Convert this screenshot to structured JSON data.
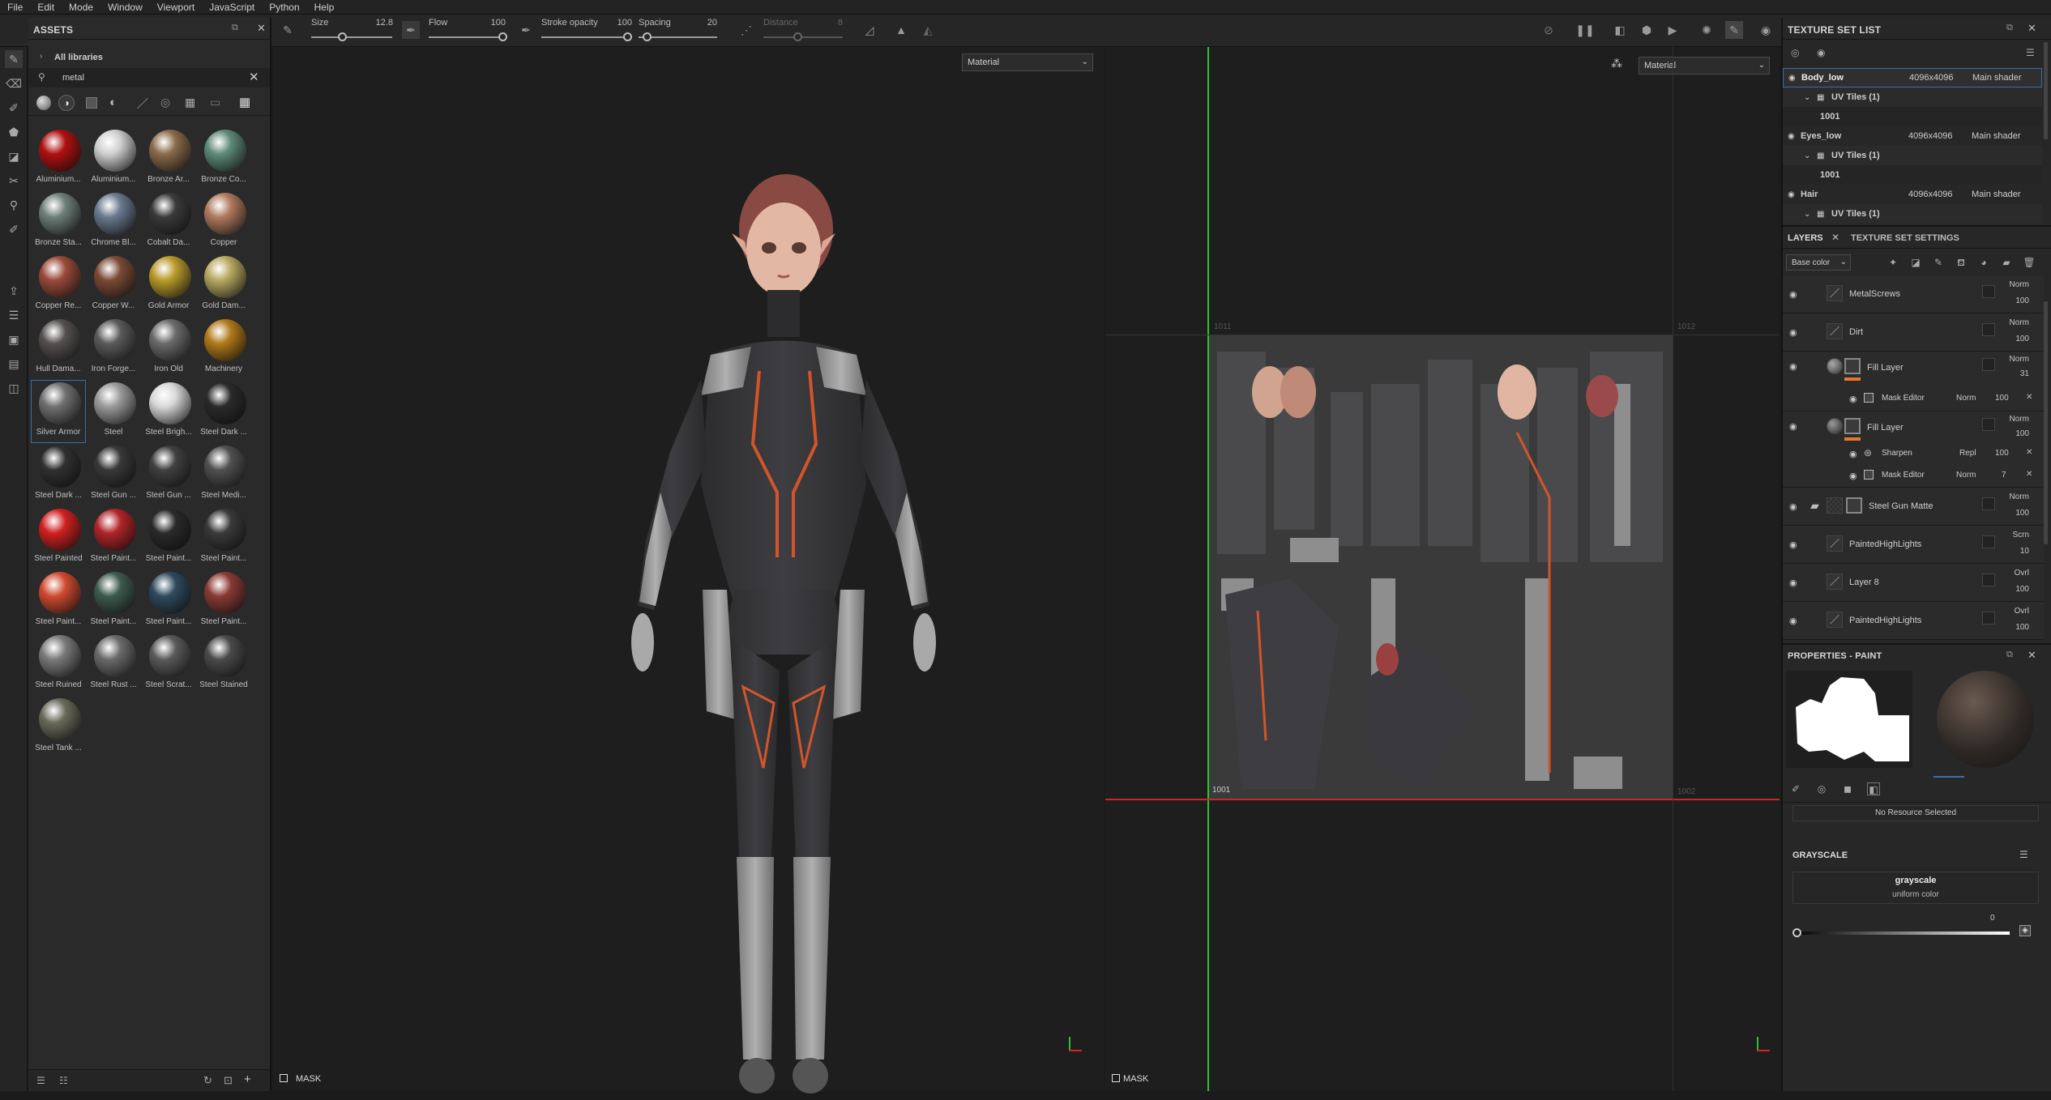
{
  "menu": [
    "File",
    "Edit",
    "Mode",
    "Window",
    "Viewport",
    "JavaScript",
    "Python",
    "Help"
  ],
  "toolbar": {
    "size_label": "Size",
    "size_value": "12.8",
    "flow_label": "Flow",
    "flow_value": "100",
    "stroke_opacity_label": "Stroke opacity",
    "stroke_opacity_value": "100",
    "spacing_label": "Spacing",
    "spacing_value": "20",
    "distance_label": "Distance",
    "distance_value": "8"
  },
  "assets": {
    "title": "ASSETS",
    "library": "All libraries",
    "search_value": "metal",
    "items": [
      {
        "name": "Aluminium...",
        "color": "#b01010"
      },
      {
        "name": "Aluminium...",
        "color": "#cfcfcf"
      },
      {
        "name": "Bronze Ar...",
        "color": "#8a6a4a"
      },
      {
        "name": "Bronze Co...",
        "color": "#5e8a78"
      },
      {
        "name": "Bronze Sta...",
        "color": "#6e7e78"
      },
      {
        "name": "Chrome Bl...",
        "color": "#6a7a90"
      },
      {
        "name": "Cobalt Da...",
        "color": "#3a3a3a"
      },
      {
        "name": "Copper",
        "color": "#b07a5e"
      },
      {
        "name": "Copper Re...",
        "color": "#9a4a3a"
      },
      {
        "name": "Copper W...",
        "color": "#7a4a34"
      },
      {
        "name": "Gold Armor",
        "color": "#b89a2a"
      },
      {
        "name": "Gold Dam...",
        "color": "#b8a860"
      },
      {
        "name": "Hull Dama...",
        "color": "#555050"
      },
      {
        "name": "Iron Forge...",
        "color": "#5a5a5a"
      },
      {
        "name": "Iron Old",
        "color": "#6a6a6a"
      },
      {
        "name": "Machinery",
        "color": "#b07a1a"
      },
      {
        "name": "Silver Armor",
        "color": "#707070"
      },
      {
        "name": "Steel",
        "color": "#9a9a9a"
      },
      {
        "name": "Steel Brigh...",
        "color": "#d8d8d8"
      },
      {
        "name": "Steel Dark ...",
        "color": "#2a2a2a"
      },
      {
        "name": "Steel Dark ...",
        "color": "#303030"
      },
      {
        "name": "Steel Gun ...",
        "color": "#383838"
      },
      {
        "name": "Steel Gun ...",
        "color": "#404040"
      },
      {
        "name": "Steel Medi...",
        "color": "#505050"
      },
      {
        "name": "Steel Painted",
        "color": "#d02020"
      },
      {
        "name": "Steel Paint...",
        "color": "#b02428"
      },
      {
        "name": "Steel Paint...",
        "color": "#2a2a2a"
      },
      {
        "name": "Steel Paint...",
        "color": "#3a3a3a"
      },
      {
        "name": "Steel Paint...",
        "color": "#d04a30"
      },
      {
        "name": "Steel Paint...",
        "color": "#3e5a4e"
      },
      {
        "name": "Steel Paint...",
        "color": "#2e4a5e"
      },
      {
        "name": "Steel Paint...",
        "color": "#8a3a34"
      },
      {
        "name": "Steel Ruined",
        "color": "#7a7a7a"
      },
      {
        "name": "Steel Rust ...",
        "color": "#6a6a6a"
      },
      {
        "name": "Steel Scrat...",
        "color": "#5a5a5a"
      },
      {
        "name": "Steel Stained",
        "color": "#4a4a4a"
      },
      {
        "name": "Steel Tank ...",
        "color": "#6a6a5a"
      }
    ]
  },
  "viewport3d": {
    "material": "Material",
    "mask": "MASK"
  },
  "viewport2d": {
    "material": "Material",
    "mask": "MASK",
    "tile_1001": "1001",
    "tile_1011": "1011",
    "tile_1012": "1012",
    "tile_1002": "1002"
  },
  "texture_sets": {
    "title": "TEXTURE SET LIST",
    "items": [
      {
        "name": "Body_low",
        "res": "4096x4096",
        "shader": "Main shader",
        "uv": "UV Tiles (1)",
        "tile": "1001"
      },
      {
        "name": "Eyes_low",
        "res": "4096x4096",
        "shader": "Main shader",
        "uv": "UV Tiles (1)",
        "tile": "1001"
      },
      {
        "name": "Hair",
        "res": "4096x4096",
        "shader": "Main shader",
        "uv": "UV Tiles (1)"
      }
    ]
  },
  "layers": {
    "tab_layers": "LAYERS",
    "tab_settings": "TEXTURE SET SETTINGS",
    "channel": "Base color",
    "items": [
      {
        "name": "MetalScrews",
        "blend": "Norm",
        "opacity": "100"
      },
      {
        "name": "Dirt",
        "blend": "Norm",
        "opacity": "100"
      },
      {
        "name": "Fill Layer",
        "blend": "Norm",
        "opacity": "31"
      },
      {
        "name": "Mask Editor",
        "blend": "Norm",
        "opacity": "100"
      },
      {
        "name": "Fill Layer",
        "blend": "Norm",
        "opacity": "100"
      },
      {
        "name": "Sharpen",
        "blend": "Repl",
        "opacity": "100"
      },
      {
        "name": "Mask Editor",
        "blend": "Norm",
        "opacity": "7"
      },
      {
        "name": "Steel Gun Matte",
        "blend": "Norm",
        "opacity": "100"
      },
      {
        "name": "PaintedHighLights",
        "blend": "Scrn",
        "opacity": "10"
      },
      {
        "name": "Layer 8",
        "blend": "Ovrl",
        "opacity": "100"
      },
      {
        "name": "PaintedHighLights",
        "blend": "Ovrl",
        "opacity": "100"
      }
    ]
  },
  "properties": {
    "title": "PROPERTIES - PAINT",
    "no_resource": "No Resource Selected",
    "grayscale_title": "GRAYSCALE",
    "grayscale_name": "grayscale",
    "grayscale_sub": "uniform color",
    "grayscale_value": "0",
    "grayscale_level": 0
  },
  "colors": {
    "accent": "#e8772e",
    "select": "#3d6ea8",
    "green_axis": "#2fbf2f",
    "red_axis": "#c82828"
  }
}
